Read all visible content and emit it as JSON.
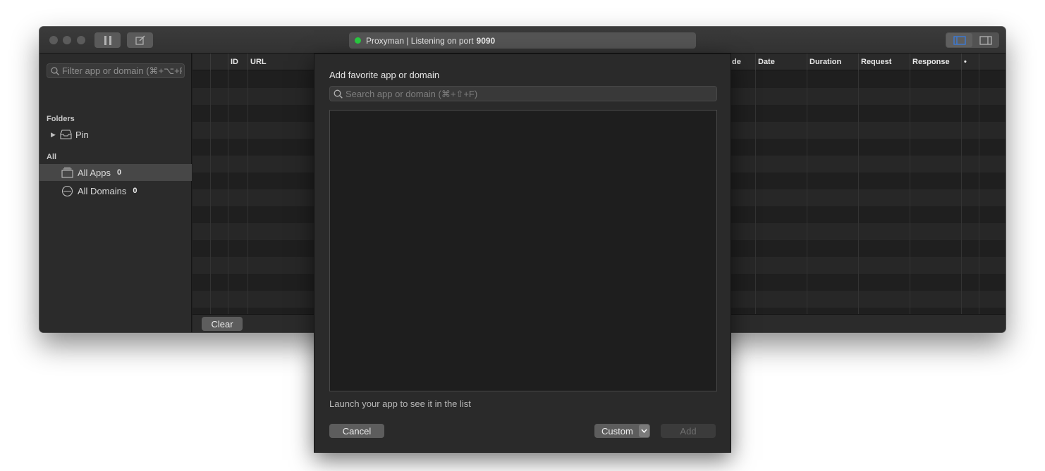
{
  "window": {
    "status_app": "Proxyman | Listening on port",
    "status_port": "9090",
    "status_color": "#29c940"
  },
  "sidebar": {
    "filter_placeholder": "Filter app or domain (⌘+⌥+F)",
    "folders_label": "Folders",
    "pin_label": "Pin",
    "all_label": "All",
    "items": [
      {
        "label": "All Apps",
        "count": "0",
        "icon": "apps-icon"
      },
      {
        "label": "All Domains",
        "count": "0",
        "icon": "globe-icon"
      }
    ]
  },
  "table": {
    "columns": [
      "ID",
      "URL",
      "de",
      "Date",
      "Duration",
      "Request",
      "Response",
      "•"
    ]
  },
  "bottom": {
    "clear_label": "Clear"
  },
  "dialog": {
    "title": "Add favorite app or domain",
    "search_placeholder": "Search app or domain (⌘+⇧+F)",
    "hint": "Launch your app to see it in the list",
    "cancel_label": "Cancel",
    "type_value": "Custom",
    "add_label": "Add"
  }
}
